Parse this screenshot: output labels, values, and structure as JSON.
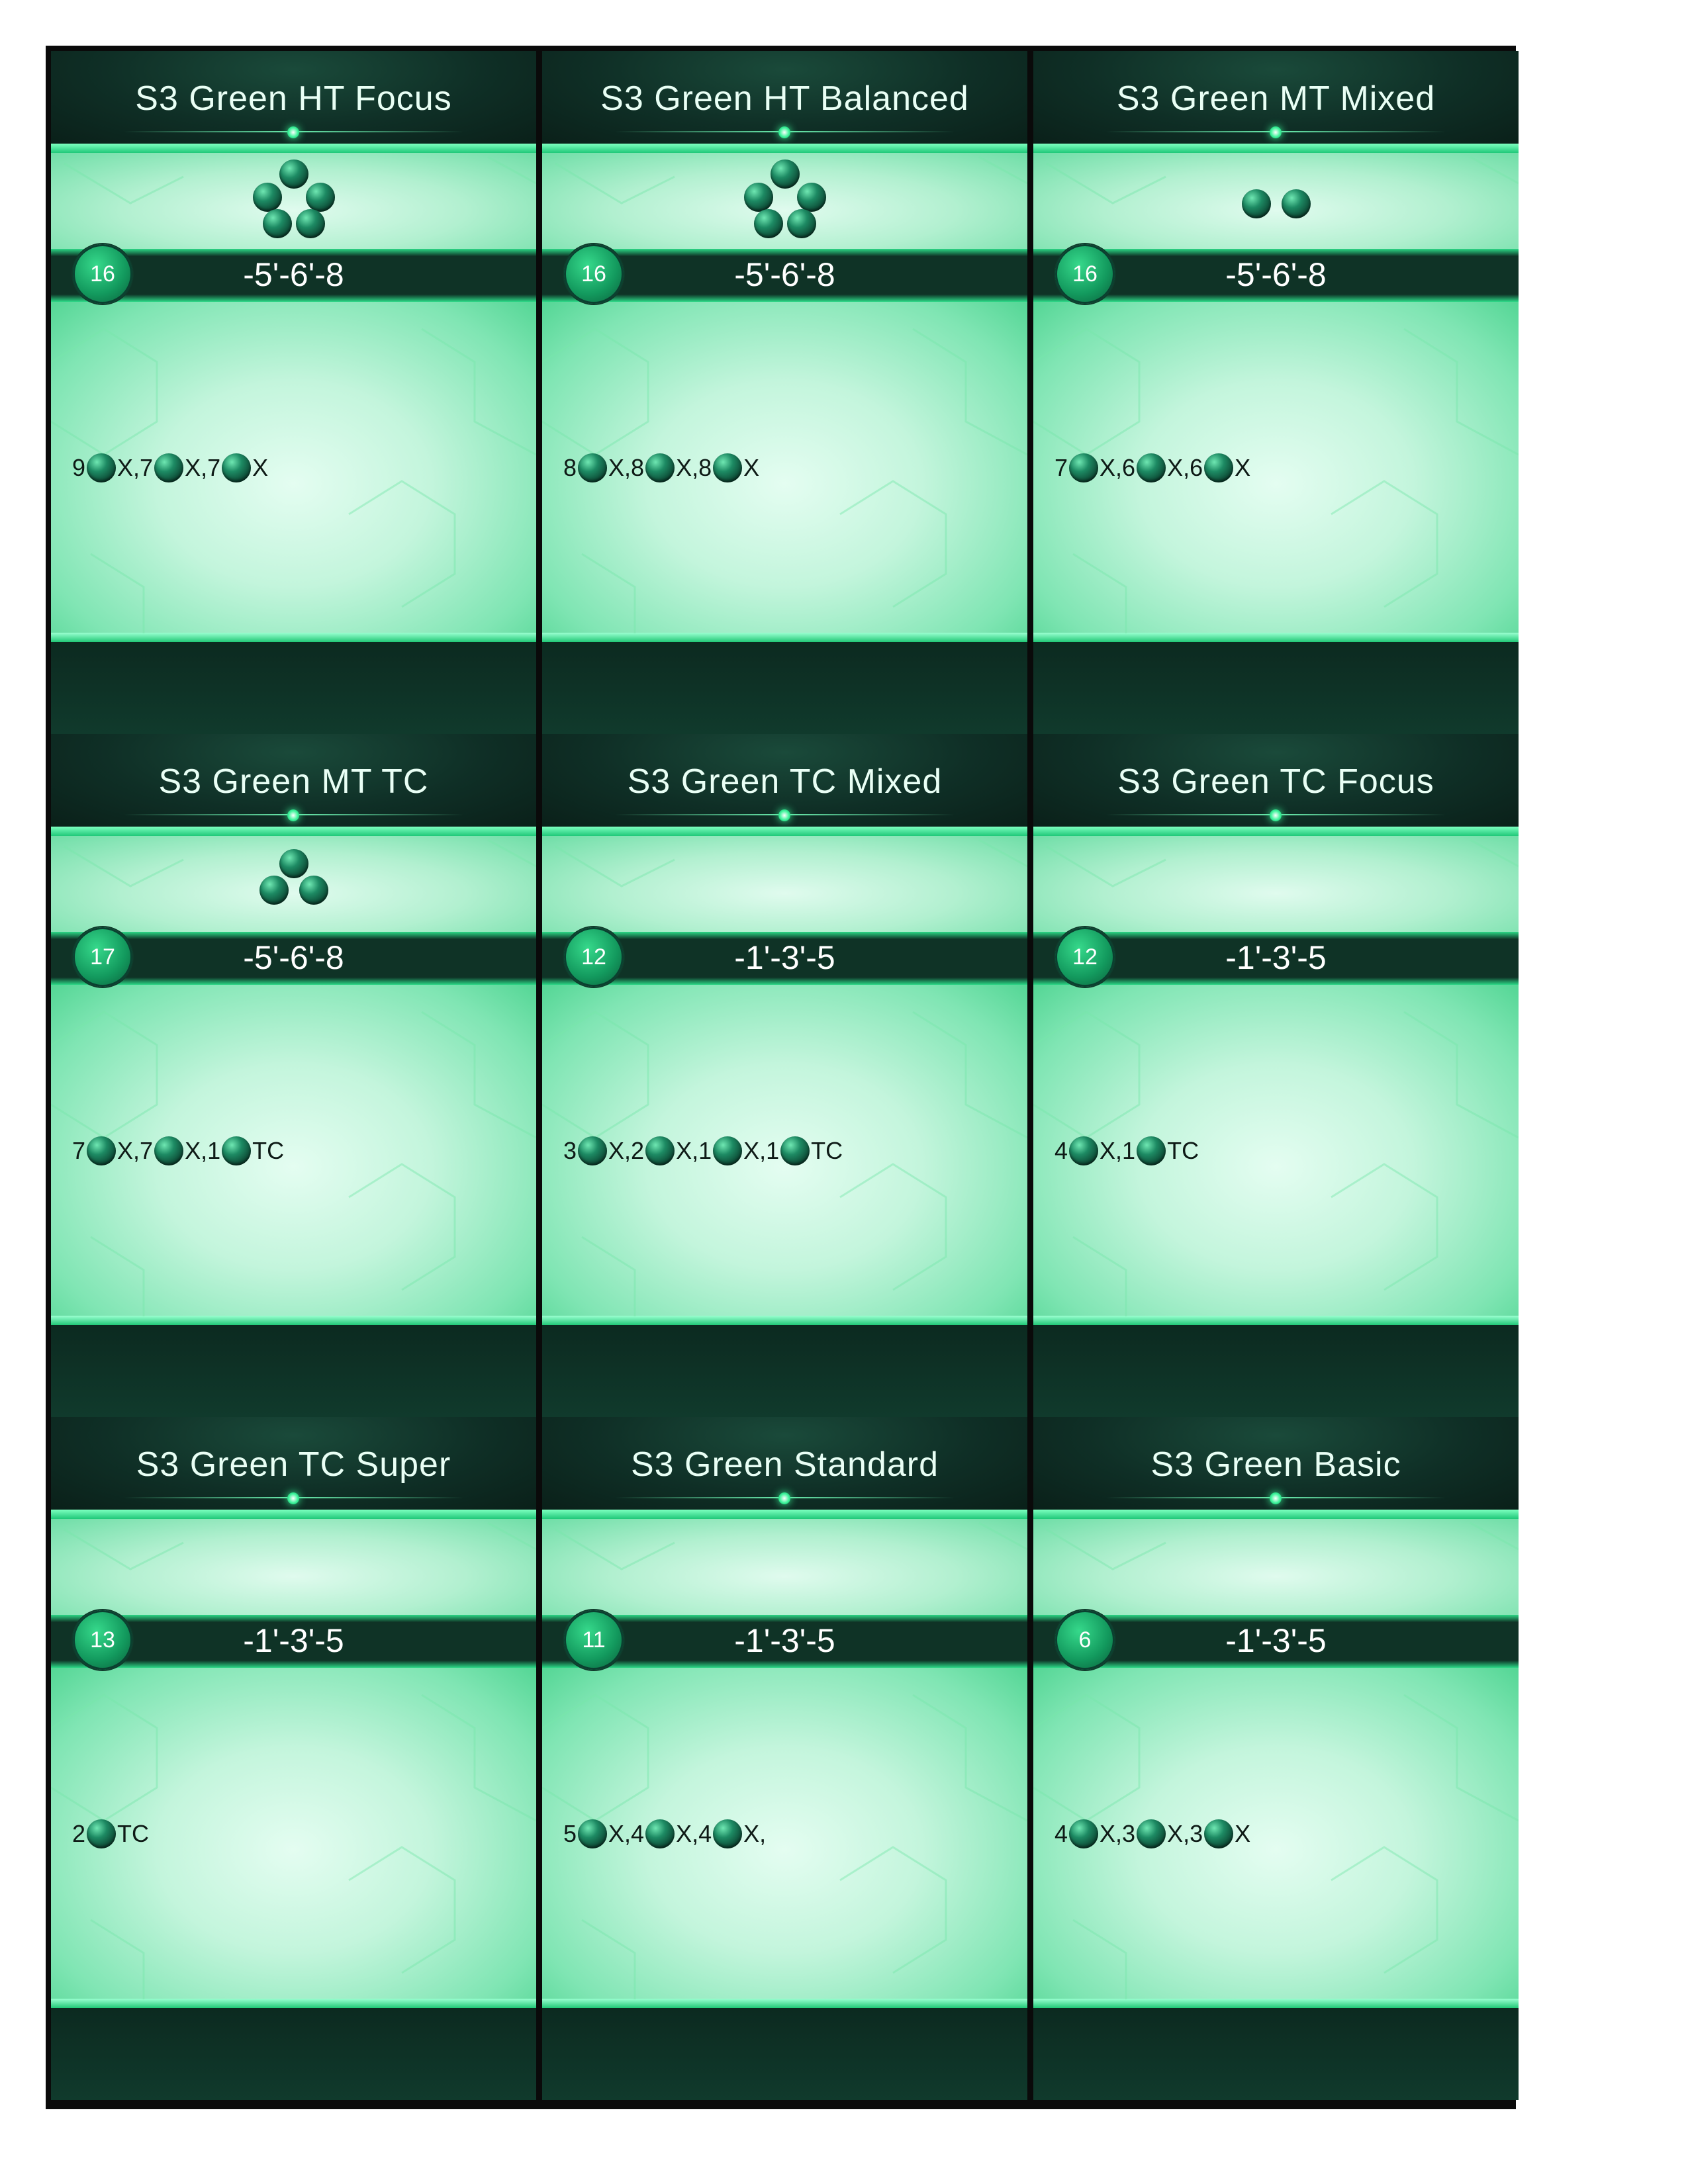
{
  "cards": [
    {
      "title": "S3 Green HT Focus",
      "badge": "16",
      "cost": "-5'-6'-8",
      "pips": 5,
      "effect": [
        {
          "t": "9"
        },
        {
          "b": 1
        },
        {
          "t": "X,7"
        },
        {
          "b": 1
        },
        {
          "t": "X,7"
        },
        {
          "b": 1
        },
        {
          "t": "X"
        }
      ]
    },
    {
      "title": "S3 Green HT Balanced",
      "badge": "16",
      "cost": "-5'-6'-8",
      "pips": 5,
      "effect": [
        {
          "t": "8"
        },
        {
          "b": 1
        },
        {
          "t": "X,8"
        },
        {
          "b": 1
        },
        {
          "t": "X,8"
        },
        {
          "b": 1
        },
        {
          "t": "X"
        }
      ]
    },
    {
      "title": "S3 Green MT Mixed",
      "badge": "16",
      "cost": "-5'-6'-8",
      "pips": 2,
      "effect": [
        {
          "t": "7"
        },
        {
          "b": 1
        },
        {
          "t": "X,6"
        },
        {
          "b": 1
        },
        {
          "t": "X,6"
        },
        {
          "b": 1
        },
        {
          "t": "X"
        }
      ]
    },
    {
      "title": "S3 Green MT TC",
      "badge": "17",
      "cost": "-5'-6'-8",
      "pips": 3,
      "effect": [
        {
          "t": "7"
        },
        {
          "b": 1
        },
        {
          "t": "X,7"
        },
        {
          "b": 1
        },
        {
          "t": "X,1"
        },
        {
          "b": 1
        },
        {
          "t": "TC"
        }
      ]
    },
    {
      "title": "S3 Green TC Mixed",
      "badge": "12",
      "cost": "-1'-3'-5",
      "pips": 0,
      "effect": [
        {
          "t": "3"
        },
        {
          "b": 1
        },
        {
          "t": "X,2"
        },
        {
          "b": 1
        },
        {
          "t": "X,1"
        },
        {
          "b": 1
        },
        {
          "t": "X,1"
        },
        {
          "b": 1
        },
        {
          "t": "TC"
        }
      ]
    },
    {
      "title": "S3 Green TC Focus",
      "badge": "12",
      "cost": "-1'-3'-5",
      "pips": 0,
      "effect": [
        {
          "t": "4"
        },
        {
          "b": 1
        },
        {
          "t": "X,1"
        },
        {
          "b": 1
        },
        {
          "t": "TC"
        }
      ]
    },
    {
      "title": "S3 Green TC Super",
      "badge": "13",
      "cost": "-1'-3'-5",
      "pips": 0,
      "effect": [
        {
          "t": "2"
        },
        {
          "b": 1
        },
        {
          "t": "TC"
        }
      ]
    },
    {
      "title": "S3 Green Standard",
      "badge": "11",
      "cost": "-1'-3'-5",
      "pips": 0,
      "effect": [
        {
          "t": "5"
        },
        {
          "b": 1
        },
        {
          "t": "X,4"
        },
        {
          "b": 1
        },
        {
          "t": "X,4"
        },
        {
          "b": 1
        },
        {
          "t": "X,"
        }
      ]
    },
    {
      "title": "S3 Green Basic",
      "badge": "6",
      "cost": "-1'-3'-5",
      "pips": 0,
      "effect": [
        {
          "t": "4"
        },
        {
          "b": 1
        },
        {
          "t": "X,3"
        },
        {
          "b": 1
        },
        {
          "t": "X,3"
        },
        {
          "b": 1
        },
        {
          "t": "X"
        }
      ]
    }
  ]
}
